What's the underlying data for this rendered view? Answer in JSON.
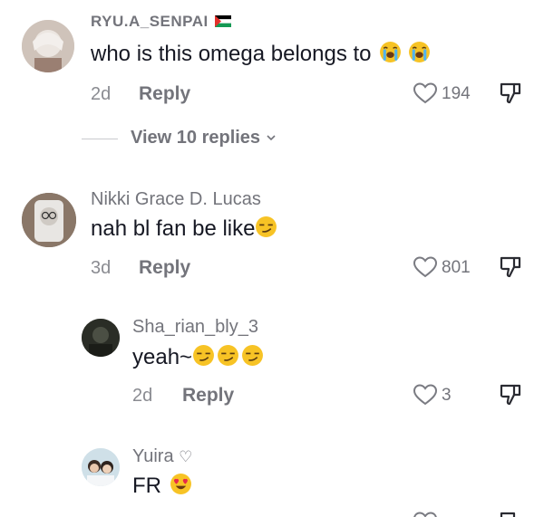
{
  "comments": [
    {
      "username": "RYU.A_SENPAI",
      "flag": "palestine-flag",
      "text": "who is this omega belongs to",
      "emojis": [
        "loudly-crying-face",
        "loudly-crying-face"
      ],
      "age": "2d",
      "reply_label": "Reply",
      "likes": "194",
      "view_replies": "View 10 replies"
    },
    {
      "username": "Nikki Grace D. Lucas",
      "text": "nah bl fan be like",
      "emojis": [
        "smirking-face"
      ],
      "age": "3d",
      "reply_label": "Reply",
      "likes": "801"
    }
  ],
  "replies": [
    {
      "username": "Sha_rian_bly_3",
      "text": "yeah~",
      "emojis": [
        "smirking-face",
        "smirking-face",
        "smirking-face"
      ],
      "age": "2d",
      "reply_label": "Reply",
      "likes": "3"
    },
    {
      "username": "Yuira",
      "username_suffix": "♡",
      "text": "FR",
      "emojis": [
        "smiling-face-with-heart-eyes"
      ]
    }
  ],
  "colors": {
    "primary_text": "#161823",
    "secondary_text": "#73747b",
    "emoji_yellow": "#f7c325"
  }
}
